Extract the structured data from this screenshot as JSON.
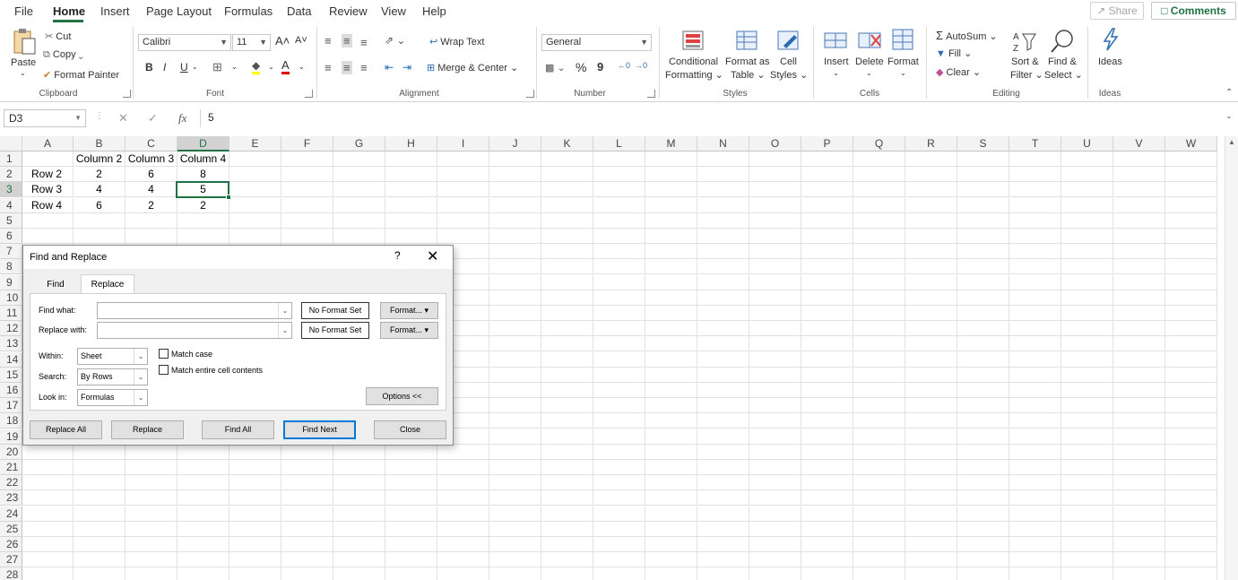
{
  "menu": {
    "tabs": [
      "File",
      "Home",
      "Insert",
      "Page Layout",
      "Formulas",
      "Data",
      "Review",
      "View",
      "Help"
    ],
    "share": "Share",
    "comments": "Comments"
  },
  "ribbon": {
    "clipboard": {
      "paste": "Paste",
      "cut": "Cut",
      "copy": "Copy",
      "format_painter": "Format Painter",
      "label": "Clipboard"
    },
    "font": {
      "name": "Calibri",
      "size": "11",
      "bold": "B",
      "italic": "I",
      "underline": "U",
      "grow": "A˄",
      "shrink": "A˅",
      "label": "Font"
    },
    "alignment": {
      "wrap": "Wrap Text",
      "merge": "Merge & Center",
      "label": "Alignment"
    },
    "number": {
      "format": "General",
      "percent": "%",
      "comma": "9",
      "label": "Number"
    },
    "styles": {
      "conditional": "Conditional",
      "formatting": "Formatting",
      "format_as": "Format as",
      "table": "Table",
      "cell": "Cell",
      "cell_styles": "Styles",
      "label": "Styles"
    },
    "cells": {
      "insert": "Insert",
      "delete": "Delete",
      "format": "Format",
      "label": "Cells"
    },
    "editing": {
      "autosum": "AutoSum",
      "fill": "Fill",
      "clear": "Clear",
      "sort": "Sort &",
      "filter": "Filter",
      "find": "Find &",
      "select": "Select",
      "label": "Editing"
    },
    "ideas": {
      "ideas": "Ideas",
      "label": "Ideas"
    }
  },
  "formula_bar": {
    "name_box": "D3",
    "fx": "fx",
    "value": "5"
  },
  "grid": {
    "columns": [
      "A",
      "B",
      "C",
      "D",
      "E",
      "F",
      "G",
      "H",
      "I",
      "J",
      "K",
      "L",
      "M",
      "N",
      "O",
      "P",
      "Q",
      "R",
      "S",
      "T",
      "U",
      "V",
      "W"
    ],
    "rows": [
      "1",
      "2",
      "3",
      "4",
      "5",
      "6",
      "7",
      "8",
      "9",
      "10",
      "11",
      "12",
      "13",
      "14",
      "15",
      "16",
      "17",
      "18",
      "19",
      "20",
      "21",
      "22",
      "23",
      "24",
      "25",
      "26",
      "27",
      "28"
    ],
    "cells": {
      "B1": "Column 2",
      "C1": "Column 3",
      "D1": "Column 4",
      "A2": "Row 2",
      "B2": "2",
      "C2": "6",
      "D2": "8",
      "A3": "Row 3",
      "B3": "4",
      "C3": "4",
      "D3": "5",
      "A4": "Row 4",
      "B4": "6",
      "C4": "2",
      "D4": "2"
    },
    "selected_cell": "D3"
  },
  "dialog": {
    "title": "Find and Replace",
    "help": "?",
    "close_x": "✕",
    "tabs": [
      "Find",
      "Replace"
    ],
    "active_tab": "Replace",
    "find_what_label": "Find what:",
    "find_what_value": "",
    "replace_with_label": "Replace with:",
    "replace_with_value": "",
    "no_format_1": "No Format Set",
    "no_format_2": "No Format Set",
    "format_btn_1": "Format...",
    "format_btn_2": "Format...",
    "within_label": "Within:",
    "within_value": "Sheet",
    "search_label": "Search:",
    "search_value": "By Rows",
    "lookin_label": "Look in:",
    "lookin_value": "Formulas",
    "match_case": "Match case",
    "match_entire": "Match entire cell contents",
    "options": "Options <<",
    "replace_all": "Replace All",
    "replace": "Replace",
    "find_all": "Find All",
    "find_next": "Find Next",
    "close": "Close"
  },
  "colors": {
    "accent": "#217346",
    "primary_button_border": "#0078d7"
  }
}
